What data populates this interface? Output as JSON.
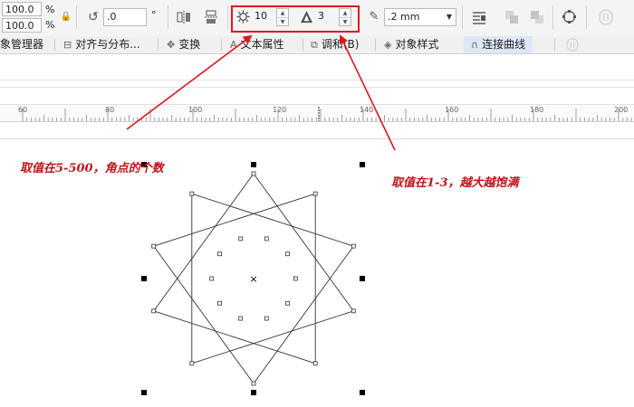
{
  "toolbar": {
    "scale_x": "100.0",
    "scale_y": "100.0",
    "percent_sign": "%",
    "rotation_value": ".0",
    "degree_sign": "°",
    "points_value": "10",
    "sharpness_value": "3",
    "outline_width": ".2 mm",
    "icons": [
      "lock-ratio-icon",
      "rotate-icon",
      "mirror-horizontal-icon",
      "mirror-vertical-icon",
      "star-points-icon",
      "star-sharpness-icon",
      "pen-icon",
      "dropdown-arrow-icon",
      "wrap-text-icon",
      "to-front-icon",
      "to-back-icon",
      "convert-to-curves-icon",
      "more-icon"
    ]
  },
  "tabs": [
    {
      "label": "象管理器"
    },
    {
      "label": "对齐与分布..."
    },
    {
      "label": "变换"
    },
    {
      "label": "文本属性"
    },
    {
      "label": "调和(B)"
    },
    {
      "label": "对象样式"
    },
    {
      "label": "连接曲线"
    }
  ],
  "ruler": {
    "labels": [
      "60",
      "80",
      "100",
      "120",
      "140",
      "160",
      "180",
      "200"
    ]
  },
  "annotations": {
    "points_note": "取值在5-500，角点的个数",
    "sharpness_note": "取值在1-3，越大越饱满"
  },
  "colors": {
    "highlight": "#e0161e",
    "annotation_text": "#c0141c",
    "active_tab": "#dde8f6"
  }
}
